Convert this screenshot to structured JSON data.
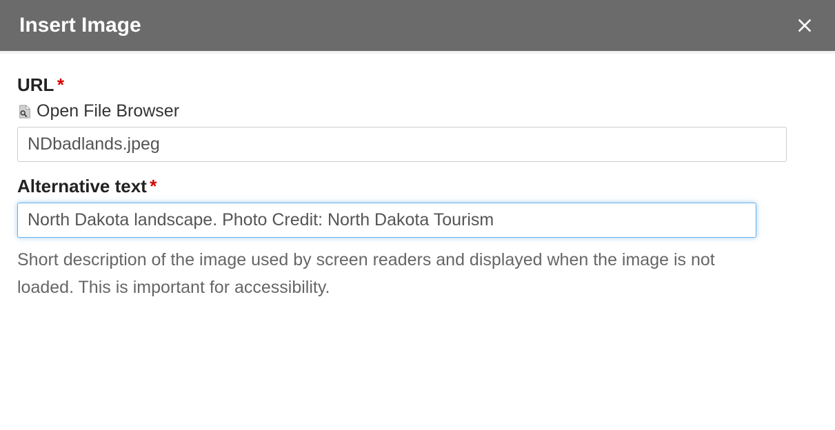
{
  "dialog": {
    "title": "Insert Image"
  },
  "url_field": {
    "label": "URL",
    "required_mark": "*",
    "file_browser_link": "Open File Browser",
    "value": "NDbadlands.jpeg"
  },
  "alt_text_field": {
    "label": "Alternative text",
    "required_mark": "*",
    "value": "North Dakota landscape. Photo Credit: North Dakota Tourism",
    "help": "Short description of the image used by screen readers and displayed when the image is not loaded. This is important for accessibility."
  }
}
